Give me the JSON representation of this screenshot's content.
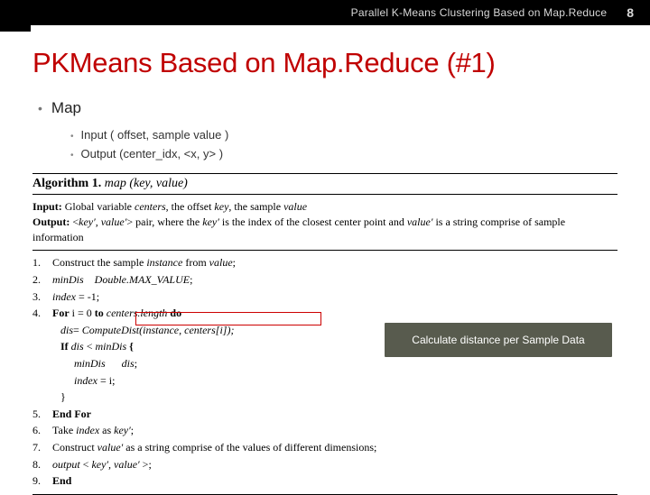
{
  "header": {
    "subtitle": "Parallel K-Means Clustering Based on Map.Reduce",
    "page": "8"
  },
  "title": "PKMeans Based on Map.Reduce (#1)",
  "bullets": {
    "main": "Map",
    "sub": [
      "Input ( offset, sample value )",
      "Output (center_idx, <x, y> )"
    ]
  },
  "callout": "Calculate distance per Sample Data",
  "alg": {
    "head_bold": "Algorithm 1.",
    "head_it": "map (key, value)",
    "input_lab": "Input:",
    "input_pre": "Global variable",
    "input_centers": "centers",
    "input_mid1": ", the offset",
    "input_key": "key",
    "input_mid2": ", the sample",
    "input_value": "value",
    "output_lab": "Output:",
    "output_pre": "<",
    "output_pair": "key′, value′",
    "output_mid1": "> pair, where the",
    "output_keyp": "key′",
    "output_mid2": "is the index of the closest center point and",
    "output_valp": "value′",
    "output_mid3": "is a string comprise of sample information",
    "steps": [
      {
        "n": "1.",
        "a": "Construct the sample",
        "b": "instance",
        "c": "from",
        "d": "value",
        "e": ";"
      },
      {
        "n": "2.",
        "a": "minDis",
        "b": "",
        "c": "Double.MAX_VALUE",
        "d": ";"
      },
      {
        "n": "3.",
        "a": "index",
        "b": "= -1;"
      },
      {
        "n": "4.",
        "a": "For",
        "b": "i = 0",
        "c": "to",
        "d": "centers.length",
        "e": "do"
      },
      {
        "a": "dis",
        "b": "=",
        "c": "ComputeDist(instance, centers[i]);"
      },
      {
        "a": "If",
        "b": "dis",
        "c": "<",
        "d": "minDis",
        "e": "{"
      },
      {
        "a": "minDis",
        "b": "dis",
        "c": ";"
      },
      {
        "a": "index",
        "b": "= i;"
      },
      {
        "a": "}"
      },
      {
        "n": "5.",
        "a": "End For"
      },
      {
        "n": "6.",
        "a": "Take",
        "b": "index",
        "c": "as",
        "d": "key′",
        "e": ";"
      },
      {
        "n": "7.",
        "a": "Construct",
        "b": "value′",
        "c": "as a string comprise of the values of different dimensions;"
      },
      {
        "n": "8.",
        "a": "output",
        "b": "<",
        "c": "key′, value′",
        "d": ">;"
      },
      {
        "n": "9.",
        "a": "End"
      }
    ]
  }
}
